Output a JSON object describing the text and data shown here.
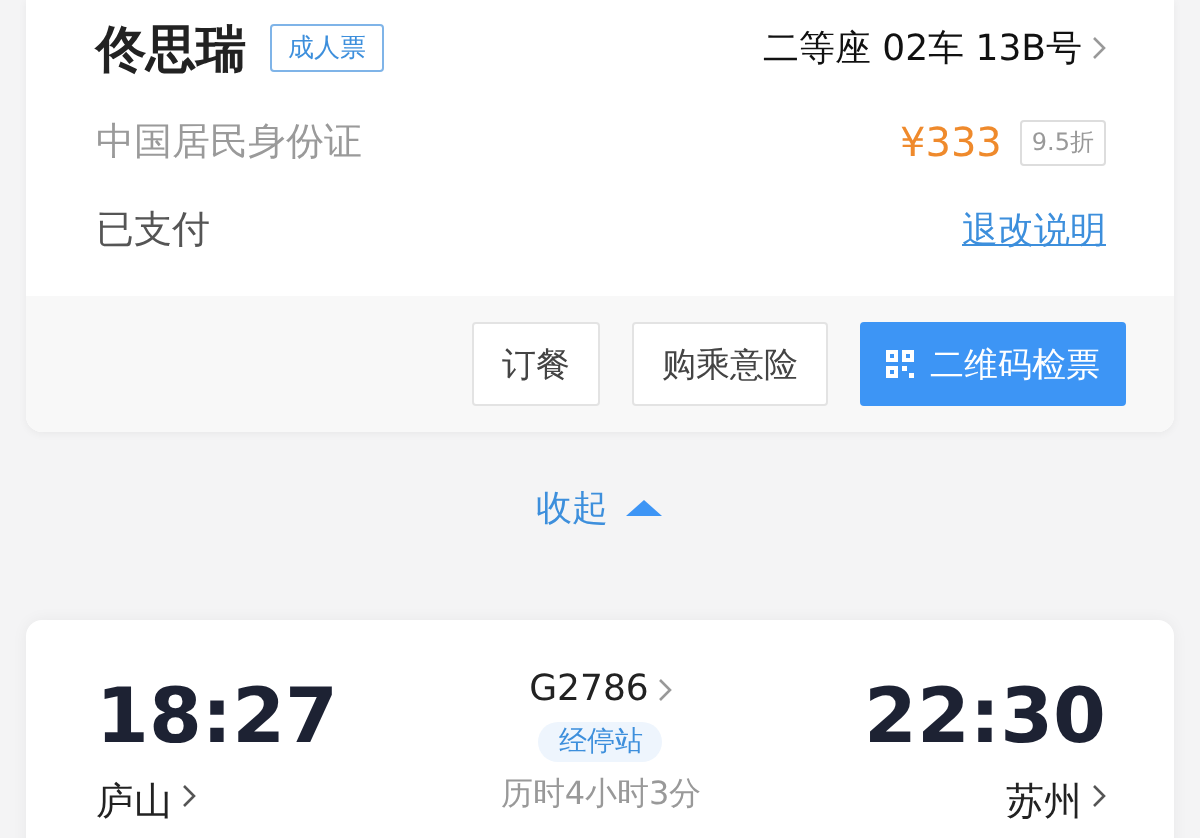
{
  "passenger": {
    "name": "佟思瑞",
    "ticket_type": "成人票",
    "seat": "二等座 02车 13B号",
    "id_type": "中国居民身份证",
    "price": "¥333",
    "discount": "9.5折",
    "status": "已支付",
    "refund_link": "退改说明"
  },
  "actions": [
    {
      "label": "订餐",
      "kind": "plain"
    },
    {
      "label": "购乘意险",
      "kind": "plain"
    },
    {
      "label": "二维码检票",
      "kind": "primary"
    }
  ],
  "collapse": {
    "label": "收起",
    "expanded": true
  },
  "trip": {
    "depart_time": "18:27",
    "train": "G2786",
    "arrive_time": "22:30",
    "stops_badge": "经停站",
    "depart_station": "庐山",
    "duration": "历时4小时3分",
    "arrive_station": "苏州"
  }
}
